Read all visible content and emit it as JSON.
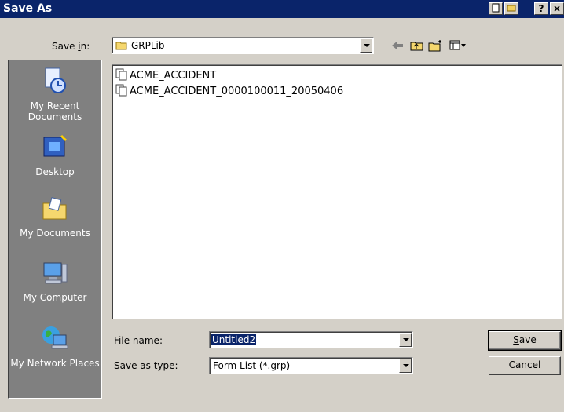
{
  "window": {
    "title": "Save As"
  },
  "title_buttons": {
    "help": "?",
    "close": "×"
  },
  "save_in": {
    "label_pre": "Save ",
    "label_mnemonic": "i",
    "label_post": "n:",
    "value": "GRPLib"
  },
  "places": [
    {
      "label": "My Recent Documents",
      "icon": "recent-documents-icon"
    },
    {
      "label": "Desktop",
      "icon": "desktop-icon"
    },
    {
      "label": "My Documents",
      "icon": "my-documents-icon"
    },
    {
      "label": "My Computer",
      "icon": "my-computer-icon"
    },
    {
      "label": "My Network Places",
      "icon": "network-places-icon"
    }
  ],
  "files": [
    {
      "name": "ACME_ACCIDENT"
    },
    {
      "name": "ACME_ACCIDENT_0000100011_20050406"
    }
  ],
  "file_name": {
    "label_pre": "File ",
    "label_mnemonic": "n",
    "label_post": "ame:",
    "value": "Untitled2"
  },
  "save_type": {
    "label_pre": "Save as ",
    "label_mnemonic": "t",
    "label_post": "ype:",
    "value": "Form List (*.grp)"
  },
  "buttons": {
    "save_mnemonic": "S",
    "save_rest": "ave",
    "cancel": "Cancel"
  },
  "colors": {
    "titlebar": "#0a246a",
    "dialog_bg": "#d4d0c8",
    "places_bg": "#808080",
    "selection": "#0a246a"
  }
}
